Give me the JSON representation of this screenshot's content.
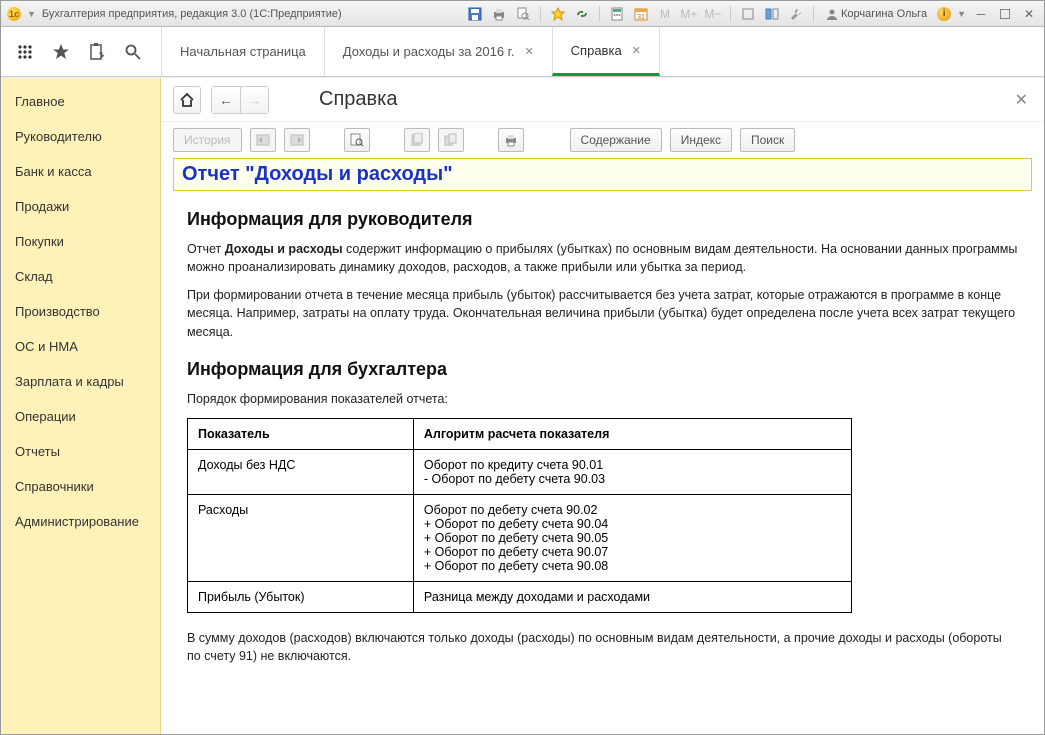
{
  "window": {
    "app_title": "Бухгалтерия предприятия, редакция 3.0  (1С:Предприятие)",
    "user_name": "Корчагина Ольга"
  },
  "top_icons": {
    "grid": "apps-grid-icon",
    "star": "favorites-star-icon",
    "clipboard": "clipboard-icon",
    "search": "search-icon"
  },
  "tabs": [
    {
      "label": "Начальная страница",
      "closable": false,
      "active": false
    },
    {
      "label": "Доходы и расходы за 2016 г.",
      "closable": true,
      "active": false
    },
    {
      "label": "Справка",
      "closable": true,
      "active": true
    }
  ],
  "sidebar": {
    "items": [
      "Главное",
      "Руководителю",
      "Банк и касса",
      "Продажи",
      "Покупки",
      "Склад",
      "Производство",
      "ОС и НМА",
      "Зарплата и кадры",
      "Операции",
      "Отчеты",
      "Справочники",
      "Администрирование"
    ]
  },
  "content": {
    "page_title": "Справка",
    "toolbar": {
      "history": "История",
      "contents": "Содержание",
      "index": "Индекс",
      "search": "Поиск"
    },
    "report_heading": "Отчет \"Доходы и расходы\"",
    "section_manager": "Информация для руководителя",
    "para1_prefix": "Отчет ",
    "para1_bold": "Доходы и расходы",
    "para1_rest": " содержит информацию о прибылях (убытках) по основным видам деятельности. На основании данных программы можно проанализировать динамику доходов, расходов, а также прибыли или убытка за период.",
    "para2": "При формировании отчета в течение месяца прибыль (убыток) рассчитывается без учета затрат, которые отражаются в программе в конце месяца. Например, затраты на оплату труда. Окончательная величина прибыли (убытка) будет определена после учета всех затрат текущего месяца.",
    "section_accountant": "Информация для бухгалтера",
    "intro_table": "Порядок формирования показателей отчета:",
    "table": {
      "head": [
        "Показатель",
        "Алгоритм расчета показателя"
      ],
      "rows": [
        {
          "indicator": "Доходы без НДС",
          "algo": "Оборот по кредиту счета 90.01\n- Оборот по дебету счета 90.03"
        },
        {
          "indicator": "Расходы",
          "algo": "Оборот по дебету счета 90.02\n+ Оборот по дебету счета 90.04\n+ Оборот по дебету счета 90.05\n+ Оборот по дебету счета 90.07\n+ Оборот по дебету счета 90.08"
        },
        {
          "indicator": "Прибыль (Убыток)",
          "algo": "Разница между доходами и расходами"
        }
      ]
    },
    "footer_para": "В сумму доходов (расходов) включаются только доходы (расходы) по основным видам деятельности, а прочие доходы и расходы (обороты по счету 91) не включаются."
  }
}
